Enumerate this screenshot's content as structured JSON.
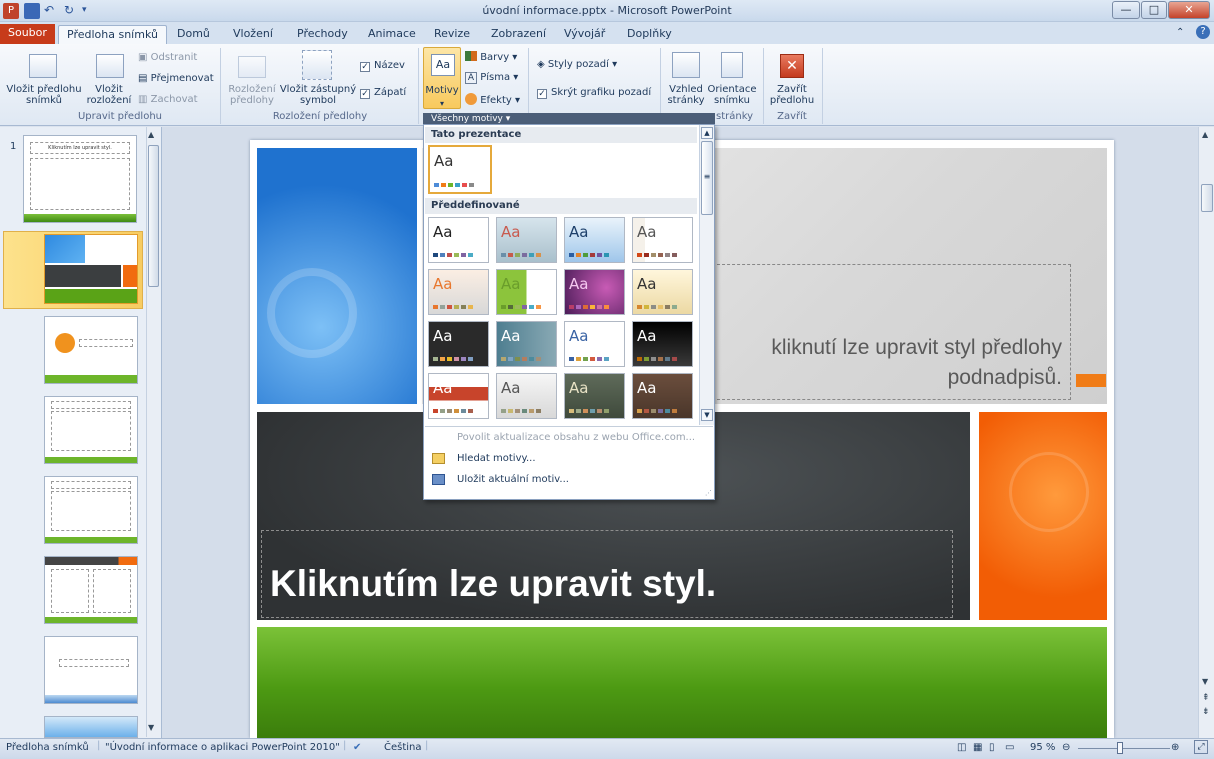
{
  "window": {
    "title": "úvodní informace.pptx - Microsoft PowerPoint",
    "minimize": "—",
    "maximize": "□",
    "close": "✕"
  },
  "tabs": [
    {
      "label": "Soubor"
    },
    {
      "label": "Předloha snímků"
    },
    {
      "label": "Domů"
    },
    {
      "label": "Vložení"
    },
    {
      "label": "Přechody"
    },
    {
      "label": "Animace"
    },
    {
      "label": "Revize"
    },
    {
      "label": "Zobrazení"
    },
    {
      "label": "Vývojář"
    },
    {
      "label": "Doplňky"
    }
  ],
  "ribbon": {
    "insert_master": "Vložit předlohu\nsnímků",
    "insert_layout": "Vložit\nrozložení",
    "delete": "Odstranit",
    "rename": "Přejmenovat",
    "preserve": "Zachovat",
    "group_edit_master": "Upravit předlohu",
    "master_layout": "Rozložení\npředlohy",
    "insert_placeholder": "Vložit zástupný\nsymbol",
    "title_chk": "Název",
    "footer_chk": "Zápatí",
    "group_master_layout": "Rozložení předlohy",
    "themes": "Motivy",
    "colors": "Barvy",
    "fonts": "Písma",
    "effects": "Efekty",
    "bg_styles": "Styly pozadí",
    "hide_bg": "Skrýt grafiku pozadí",
    "page_setup": "Vzhled\nstránky",
    "orientation": "Orientace\nsnímku",
    "group_page": "stránky",
    "close_master": "Zavřít\npředlohu",
    "group_close": "Zavřít",
    "all_themes": "Všechny motivy"
  },
  "themes_dropdown": {
    "section_current": "Tato prezentace",
    "section_builtin": "Předdefinované",
    "sample": "Aa",
    "allow_update": "Povolit aktualizace obsahu z webu Office.com...",
    "browse": "Hledat motivy...",
    "save": "Uložit aktuální motiv..."
  },
  "slide": {
    "subtitle_line1": "kliknutí lze upravit styl předlohy",
    "subtitle_line2": "podnadpisů.",
    "title": "Kliknutím lze upravit styl."
  },
  "thumbs": {
    "num1": "1",
    "t1": "Kliknutím lze upravit styl."
  },
  "status": {
    "view": "Předloha snímků",
    "theme": "\"Úvodní informace o aplikaci PowerPoint 2010\"",
    "language": "Čeština",
    "zoom": "95 %"
  },
  "colors": {
    "accent_orange": "#f07c17",
    "file_tab": "#c73b1a",
    "grass": "#5aa317"
  }
}
